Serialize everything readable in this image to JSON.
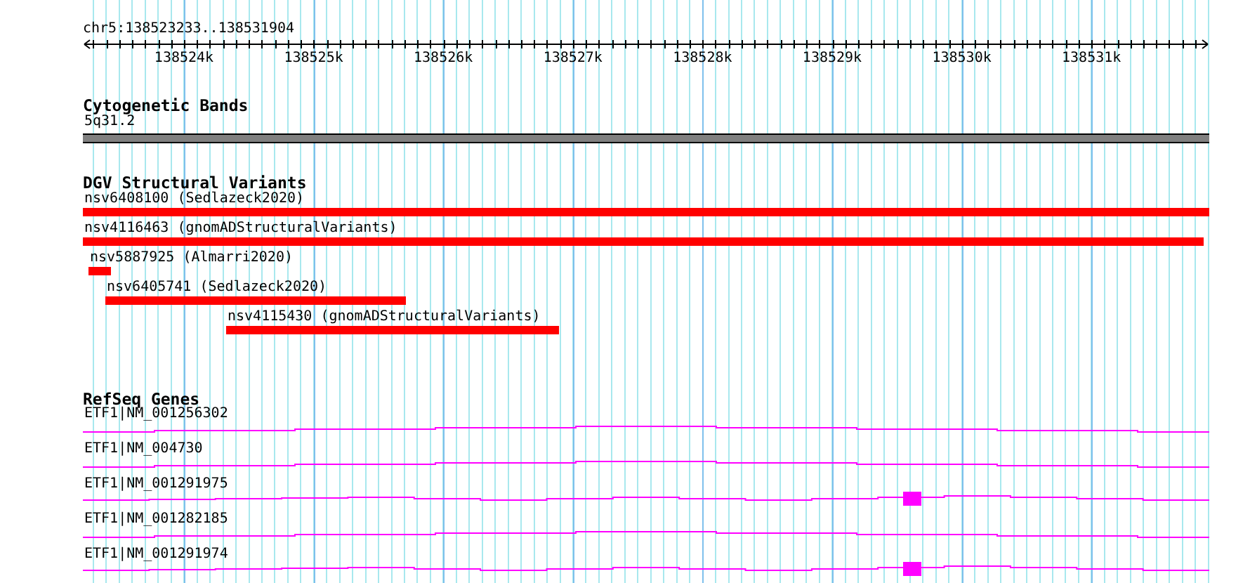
{
  "location": "chr5:138523233..138531904",
  "axis": {
    "labels": [
      "138524k",
      "138525k",
      "138526k",
      "138527k",
      "138528k",
      "138529k",
      "138530k",
      "138531k"
    ]
  },
  "tracks": [
    {
      "kind": "cytoband",
      "title": "Cytogenetic Bands",
      "features": [
        {
          "label": "5q31.2"
        }
      ]
    },
    {
      "kind": "variants",
      "title": "DGV Structural Variants",
      "features": [
        {
          "label": "nsv6408100 (Sedlazeck2020)"
        },
        {
          "label": "nsv4116463 (gnomADStructuralVariants)"
        },
        {
          "label": "nsv5887925 (Almarri2020)"
        },
        {
          "label": "nsv6405741 (Sedlazeck2020)"
        },
        {
          "label": "nsv4115430 (gnomADStructuralVariants)"
        }
      ]
    },
    {
      "kind": "genes",
      "title": "RefSeq Genes",
      "features": [
        {
          "label": "ETF1|NM_001256302",
          "kind": "plain"
        },
        {
          "label": "ETF1|NM_004730",
          "kind": "plain"
        },
        {
          "label": "ETF1|NM_001291975",
          "kind": "boxed"
        },
        {
          "label": "ETF1|NM_001282185",
          "kind": "plain"
        },
        {
          "label": "ETF1|NM_001291974",
          "kind": "boxed"
        }
      ]
    }
  ]
}
